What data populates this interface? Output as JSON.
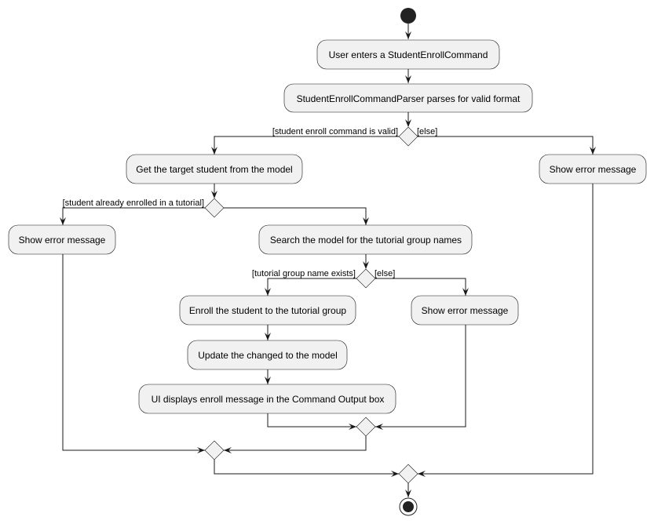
{
  "diagram": {
    "type": "activity",
    "actions": {
      "enter": "User enters a StudentEnrollCommand",
      "parse": "StudentEnrollCommandParser parses for valid format",
      "get_student": "Get the target student from the model",
      "error_invalid": "Show error message",
      "error_enrolled": "Show error message",
      "search": "Search the model for the tutorial group names",
      "enroll": "Enroll the student to the tutorial group",
      "error_no_group": "Show error message",
      "update": "Update the changed to the model",
      "ui_display": "UI displays enroll message in the Command Output box"
    },
    "guards": {
      "valid": "[student enroll command is valid]",
      "invalid_else": "[else]",
      "already_enrolled": "[student already enrolled in a tutorial]",
      "group_exists": "[tutorial group name exists]",
      "group_else": "[else]"
    },
    "colors": {
      "node_fill": "#f1f1f1",
      "stroke": "#181818",
      "start": "#222222"
    }
  }
}
